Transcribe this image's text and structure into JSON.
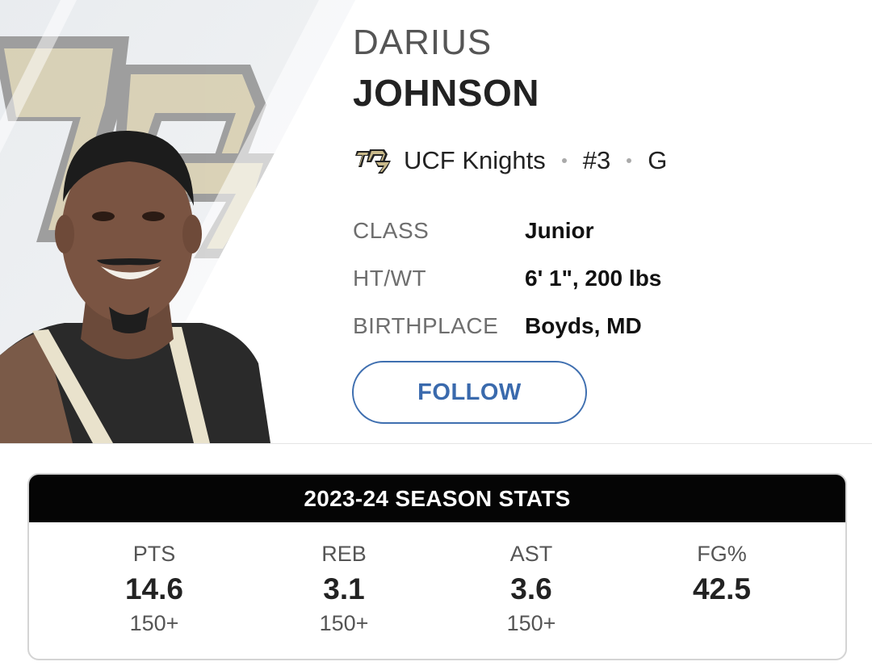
{
  "player": {
    "first_name": "DARIUS",
    "last_name": "JOHNSON",
    "team": "UCF Knights",
    "team_logo_text": "UCF",
    "jersey": "#3",
    "position": "G"
  },
  "bio": [
    {
      "label": "CLASS",
      "value": "Junior"
    },
    {
      "label": "HT/WT",
      "value": "6' 1\", 200 lbs"
    },
    {
      "label": "BIRTHPLACE",
      "value": "Boyds, MD"
    }
  ],
  "follow_label": "FOLLOW",
  "season_stats": {
    "title": "2023-24 SEASON STATS",
    "items": [
      {
        "label": "PTS",
        "value": "14.6",
        "rank": "150+"
      },
      {
        "label": "REB",
        "value": "3.1",
        "rank": "150+"
      },
      {
        "label": "AST",
        "value": "3.6",
        "rank": "150+"
      },
      {
        "label": "FG%",
        "value": "42.5",
        "rank": ""
      }
    ]
  },
  "colors": {
    "accent": "#3a6aad",
    "header_bg": "#050505",
    "ucf_gold": "#c9b98a"
  },
  "icons": {
    "team_logo": "ucf-knights-logo-icon",
    "player_photo": "player-headshot-image"
  }
}
